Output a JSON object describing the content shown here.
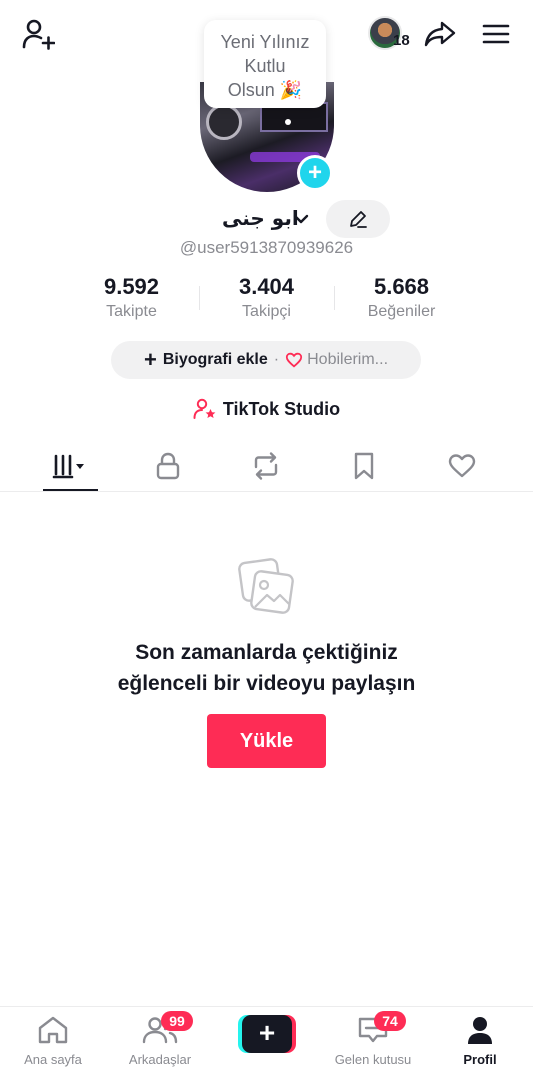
{
  "header": {
    "add_friend_icon": "person-plus-icon",
    "friend_count": "18",
    "share_icon": "share-arrow-icon",
    "menu_icon": "hamburger-icon"
  },
  "profile": {
    "new_year_note": [
      "Yeni Yılınız",
      "Kutlu",
      "Olsun 🎉"
    ],
    "name": "ابو جنى",
    "username": "@user5913870939626",
    "add_photo_label": "+"
  },
  "stats": [
    {
      "value": "9.592",
      "label": "Takipte"
    },
    {
      "value": "3.404",
      "label": "Takipçi"
    },
    {
      "value": "5.668",
      "label": "Beğeniler"
    }
  ],
  "bio": {
    "add_label": "Biyografi ekle",
    "separator": "·",
    "hobbies_label": "Hobilerim..."
  },
  "studio": {
    "label": "TikTok Studio"
  },
  "tabs": [
    "videos-grid",
    "private-lock",
    "reposts",
    "saved-bookmark",
    "liked-heart"
  ],
  "empty_state": {
    "title_line1": "Son zamanlarda çektiğiniz",
    "title_line2": "eğlenceli bir videoyu paylaşın",
    "upload_label": "Yükle"
  },
  "bottom_nav": {
    "home": "Ana sayfa",
    "friends": "Arkadaşlar",
    "friends_badge": "99",
    "create": "+",
    "inbox": "Gelen kutusu",
    "inbox_badge": "74",
    "profile": "Profil"
  },
  "colors": {
    "accent": "#fe2c55",
    "cyan": "#25f4ee",
    "text": "#161823",
    "muted": "#8a8b91"
  }
}
